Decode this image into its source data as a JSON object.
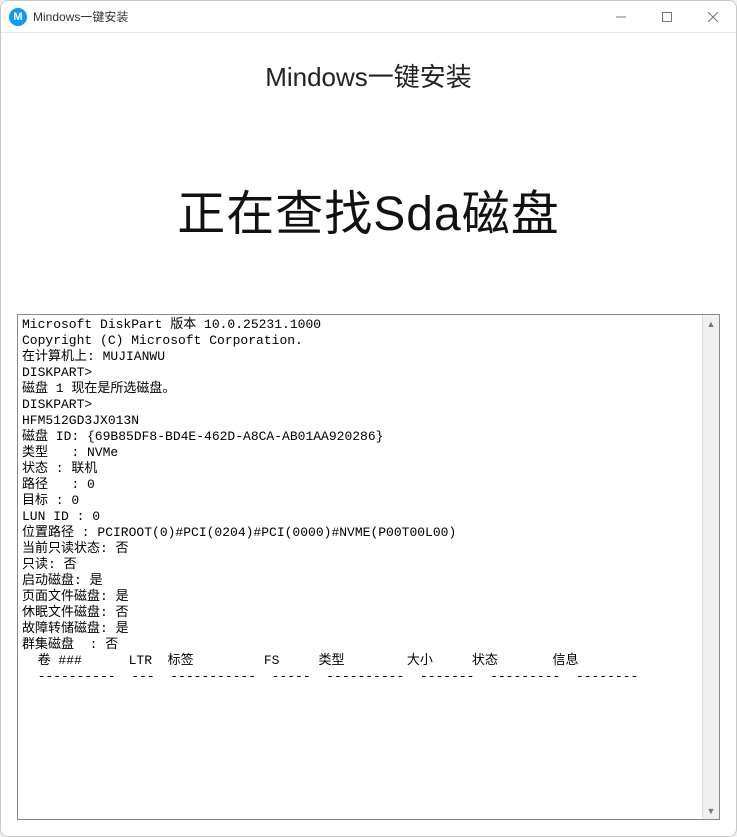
{
  "titlebar": {
    "app_icon_letter": "M",
    "title": "Mindows一键安装"
  },
  "header": {
    "page_title": "Mindows一键安装"
  },
  "status": {
    "text": "正在查找Sda磁盘"
  },
  "console": {
    "text": "Microsoft DiskPart 版本 10.0.25231.1000\nCopyright (C) Microsoft Corporation.\n在计算机上: MUJIANWU\nDISKPART>\n磁盘 1 现在是所选磁盘。\nDISKPART>\nHFM512GD3JX013N\n磁盘 ID: {69B85DF8-BD4E-462D-A8CA-AB01AA920286}\n类型   : NVMe\n状态 : 联机\n路径   : 0\n目标 : 0\nLUN ID : 0\n位置路径 : PCIROOT(0)#PCI(0204)#PCI(0000)#NVME(P00T00L00)\n当前只读状态: 否\n只读: 否\n启动磁盘: 是\n页面文件磁盘: 是\n休眠文件磁盘: 否\n故障转储磁盘: 是\n群集磁盘  : 否\n  卷 ###      LTR  标签         FS     类型        大小     状态       信息\n  ----------  ---  -----------  -----  ----------  -------  ---------  --------"
  }
}
